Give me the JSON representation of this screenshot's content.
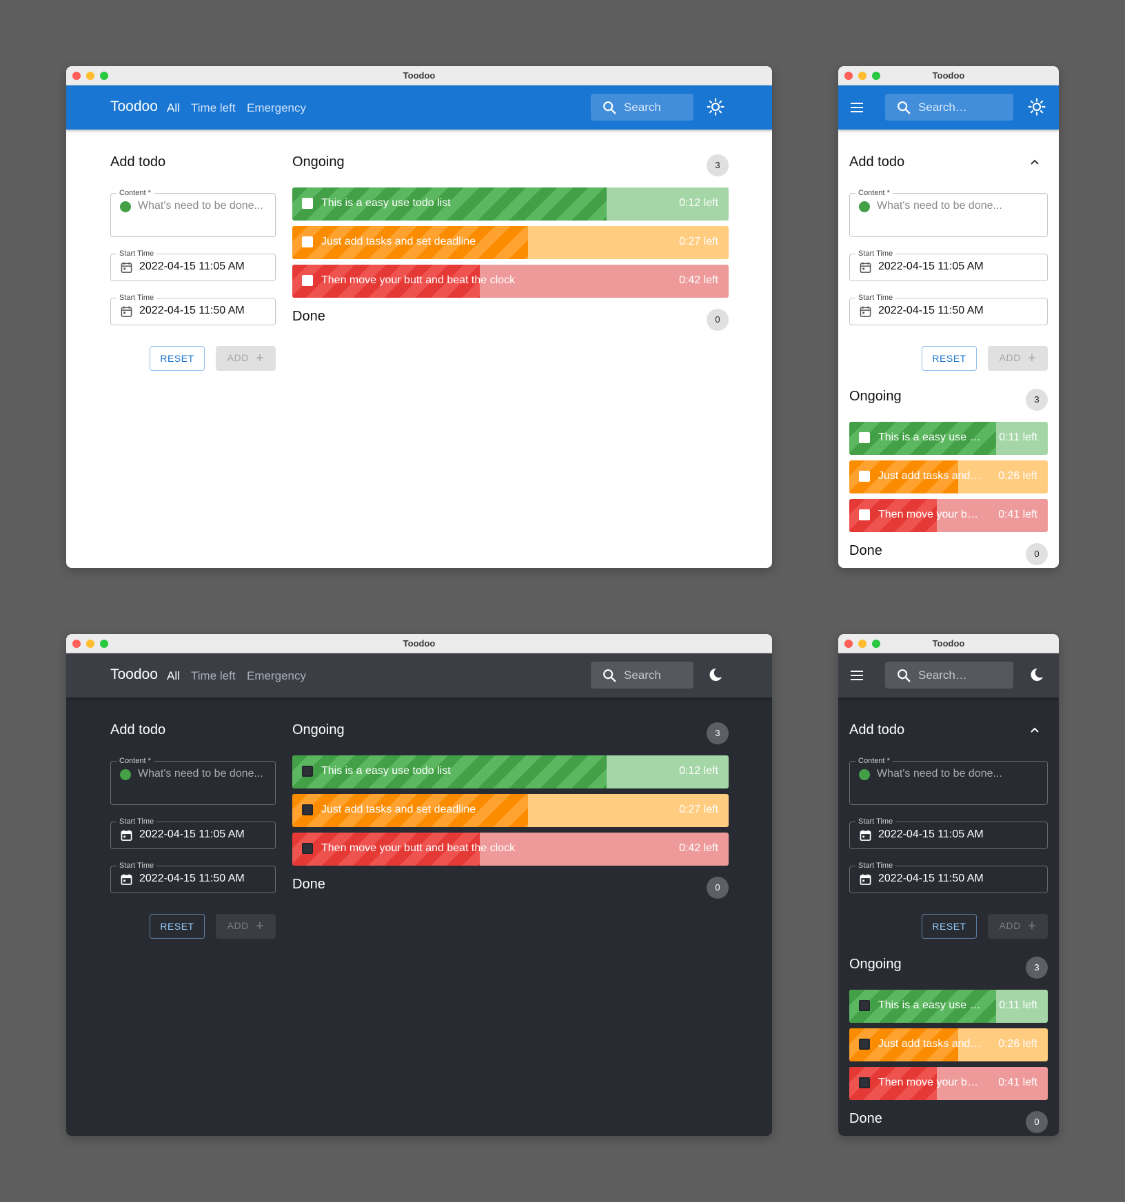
{
  "window": {
    "title": "Toodoo"
  },
  "appbar": {
    "brand": "Toodoo",
    "nav": [
      "All",
      "Time left",
      "Emergency"
    ],
    "search_placeholder": "Search",
    "search_placeholder_mobile": "Search…"
  },
  "form": {
    "title": "Add todo",
    "content_label": "Content *",
    "content_placeholder": "What's need to be done...",
    "start_label": "Start Time",
    "end_label": "Start Time",
    "start_value": "2022-04-15 11:05 AM",
    "end_value": "2022-04-15 11:50 AM",
    "reset_label": "RESET",
    "add_label": "ADD"
  },
  "ongoing": {
    "title": "Ongoing",
    "count": "3",
    "items": [
      {
        "text": "This is a easy use todo list",
        "text_short": "This is a easy use …",
        "left": "0:12 left",
        "left_mobile": "0:11 left",
        "color": "green",
        "progress_desktop": 0.72,
        "progress_mobile": 0.74
      },
      {
        "text": "Just add tasks and set deadline",
        "text_short": "Just add tasks and…",
        "left": "0:27 left",
        "left_mobile": "0:26 left",
        "color": "orange",
        "progress_desktop": 0.54,
        "progress_mobile": 0.55
      },
      {
        "text": "Then move your butt and beat the clock",
        "text_short": "Then move your b…",
        "left": "0:42 left",
        "left_mobile": "0:41 left",
        "color": "red",
        "progress_desktop": 0.43,
        "progress_mobile": 0.44
      }
    ]
  },
  "done": {
    "title": "Done",
    "count": "0"
  },
  "colors": {
    "primary": "#1976d2",
    "dark_bg": "#282b31",
    "green": "#43a047",
    "orange": "#fb8c00",
    "red": "#e53935"
  }
}
